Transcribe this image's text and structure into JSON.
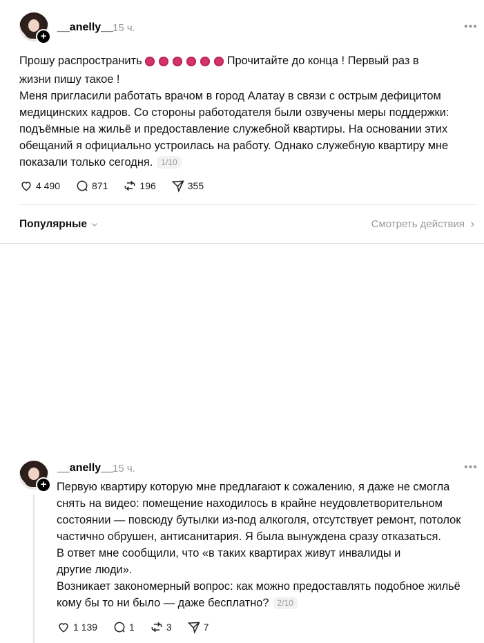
{
  "post1": {
    "username": "__anelly__",
    "time": "15 ч.",
    "more_icon": "more-horizontal-icon",
    "text_part1": "Прошу распространить ",
    "text_part2": " Прочитайте до конца ! Первый раз в\nжизни пишу такое !\nМеня пригласили работать врачом в город Алатау в связи с острым дефицитом\nмедицинских кадров. Со стороны работодателя были озвучены меры поддержки:\nподъёмные на жильё и предоставление служебной квартиры. На основании этих\nобещаний я официально устроилась на работу. Однако служебную квартиру мне\nпоказали только сегодня.",
    "counter": "1/10",
    "likes": "4 490",
    "comments": "871",
    "reposts": "196",
    "shares": "355"
  },
  "sort": {
    "label": "Популярные",
    "view_activity": "Смотреть действия"
  },
  "post2": {
    "username": "__anelly__",
    "time": "15 ч.",
    "text": "Первую квартиру которую мне предлагают к сожалению, я даже не смогла\nснять на видео: помещение находилось в крайне неудовлетворительном\nсостоянии — повсюду бутылки из-под алкоголя, отсутствует ремонт, потолок\nчастично обрушен, антисанитария. Я была вынуждена сразу отказаться.\nВ ответ мне сообщили, что «в таких квартирах живут инвалиды и\nдругие люди».\nВозникает закономерный вопрос: как можно предоставлять подобное жильё\nкому бы то ни было — даже бесплатно?",
    "counter": "2/10",
    "likes": "1 139",
    "comments": "1",
    "reposts": "3",
    "shares": "7"
  },
  "colors": {
    "accent_dots": "#d6336c",
    "muted": "#999999",
    "divider": "#e3e3e3"
  }
}
